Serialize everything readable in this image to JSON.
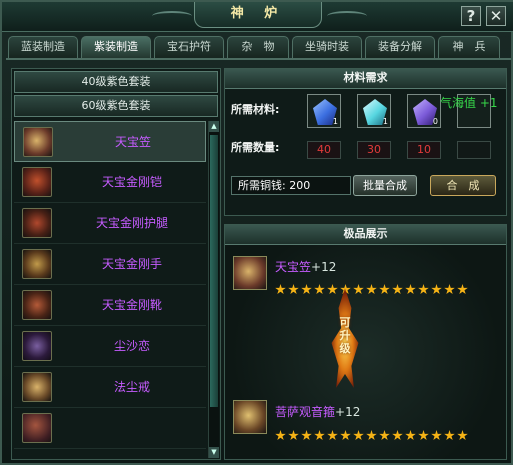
{
  "window": {
    "title": "神 炉",
    "help_label": "?",
    "close_label": "✕"
  },
  "tabs": [
    {
      "label": "蓝装制造",
      "active": false
    },
    {
      "label": "紫装制造",
      "active": true
    },
    {
      "label": "宝石护符",
      "active": false
    },
    {
      "label": "杂　物",
      "active": false
    },
    {
      "label": "坐骑时装",
      "active": false
    },
    {
      "label": "装备分解",
      "active": false
    },
    {
      "label": "神　兵",
      "active": false
    }
  ],
  "left": {
    "categories": [
      "40级紫色套装",
      "60级紫色套装"
    ],
    "items": [
      {
        "name": "天宝笠",
        "icon": "helmet-icon",
        "selected": true
      },
      {
        "name": "天宝金刚铠",
        "icon": "armor-icon",
        "selected": false
      },
      {
        "name": "天宝金刚护腿",
        "icon": "leg-guard-icon",
        "selected": false
      },
      {
        "name": "天宝金刚手",
        "icon": "glove-icon",
        "selected": false
      },
      {
        "name": "天宝金刚靴",
        "icon": "boot-icon",
        "selected": false
      },
      {
        "name": "尘沙恋",
        "icon": "amulet-icon",
        "selected": false
      },
      {
        "name": "法尘戒",
        "icon": "ring-icon",
        "selected": false
      },
      {
        "name": "",
        "icon": "weapon-icon",
        "selected": false
      }
    ]
  },
  "materials": {
    "header": "材料需求",
    "label_materials": "所需材料:",
    "label_quantity": "所需数量:",
    "slots": [
      {
        "icon": "blue-crystal-icon",
        "owned": "1",
        "color": "#3b6ee0"
      },
      {
        "icon": "cyan-crystal-icon",
        "owned": "1",
        "color": "#56d6e0"
      },
      {
        "icon": "purple-crystal-icon",
        "owned": "0",
        "color": "#7b5ad8"
      }
    ],
    "required": [
      "40",
      "30",
      "10"
    ],
    "qihai": "气海值 +1",
    "cost": "所需铜钱: 200",
    "batch_button": "批量合成",
    "craft_button": "合　成"
  },
  "showcase": {
    "header": "极品展示",
    "top": {
      "name": "天宝笠",
      "plus": "+12",
      "stars": 15,
      "icon": "helmet-icon"
    },
    "upgrade_text": "可升级",
    "bottom": {
      "name": "菩萨观音箍",
      "plus": "+12",
      "stars": 15,
      "icon": "headband-icon"
    }
  },
  "colors": {
    "item_name": "#c65cff",
    "qihai": "#37d84a",
    "required_qty": "#e23b3b",
    "star": "#f5b316"
  }
}
